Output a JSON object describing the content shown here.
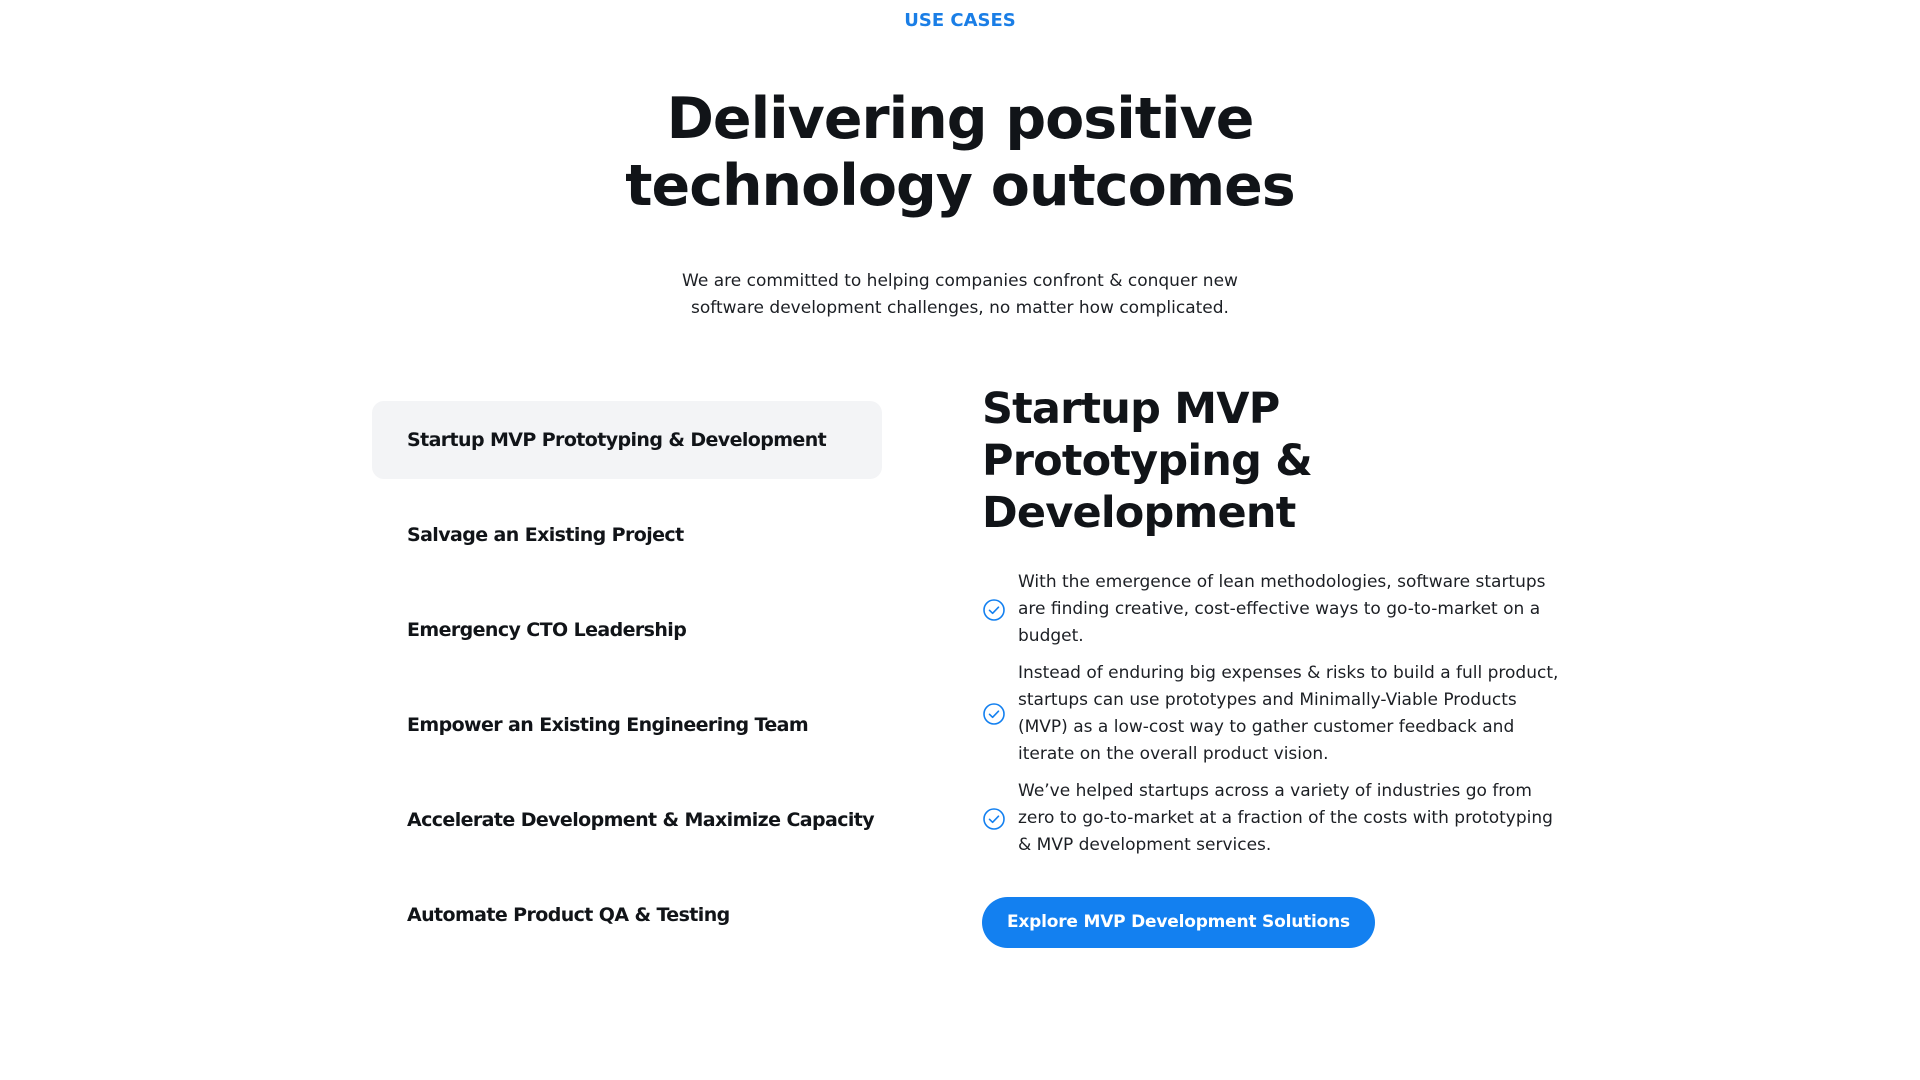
{
  "section": {
    "eyebrow": "USE CASES",
    "title": "Delivering positive technology outcomes",
    "subtitle": "We are committed to helping companies confront & conquer new software development challenges, no matter how complicated."
  },
  "tabs": [
    {
      "label": "Startup MVP Prototyping & Development",
      "active": true
    },
    {
      "label": "Salvage an Existing Project",
      "active": false
    },
    {
      "label": "Emergency CTO Leadership",
      "active": false
    },
    {
      "label": "Empower an Existing Engineering Team",
      "active": false
    },
    {
      "label": "Accelerate Development & Maximize Capacity",
      "active": false
    },
    {
      "label": "Automate Product QA & Testing",
      "active": false
    }
  ],
  "detail": {
    "title": "Startup MVP Prototyping & Development",
    "points": [
      {
        "icon": "check-circle-icon",
        "text": "With the emergence of lean methodologies, software startups are finding creative, cost-effective ways to go-to-market on a budget."
      },
      {
        "icon": "check-circle-icon",
        "text": "Instead of enduring big expenses & risks to build a full product, startups can use prototypes and Minimally-Viable Products (MVP) as a low-cost way to gather customer feedback and iterate on the overall product vision."
      },
      {
        "icon": "check-circle-icon",
        "text": "We’ve helped startups across a variety of industries go from zero to go-to-market at a fraction of the costs with prototyping & MVP development services."
      }
    ],
    "cta_label": "Explore MVP Development Solutions"
  },
  "colors": {
    "accent": "#1380f0",
    "eyebrow": "#1a7ee6",
    "heading": "#111418",
    "body": "#1c1f24",
    "active_tab_bg": "#f3f4f6"
  }
}
